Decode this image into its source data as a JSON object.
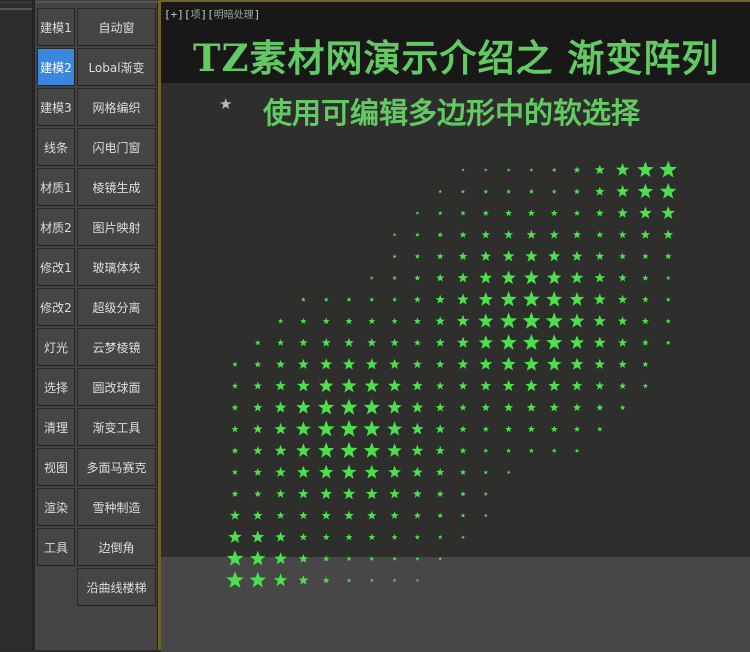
{
  "left_column": [
    "建模1",
    "建模2",
    "建模3",
    "线条",
    "材质1",
    "材质2",
    "修改1",
    "修改2",
    "灯光",
    "选择",
    "清理",
    "视图",
    "渲染",
    "工具"
  ],
  "active_index": 1,
  "right_column": [
    "自动窗",
    "Lobal渐变",
    "网格编织",
    "闪电门窗",
    "棱镜生成",
    "图片映射",
    "玻璃体块",
    "超级分离",
    "云梦棱镜",
    "圆改球面",
    "渐变工具",
    "多面马赛克",
    "雪种制造",
    "边倒角",
    "沿曲线楼梯"
  ],
  "viewport": {
    "label_plus": "[+]",
    "label_view": "项",
    "label_shading": "明暗处理",
    "title": "TZ素材网演示介绍之 渐变阵列",
    "subtitle": "使用可编辑多边形中的软选择"
  },
  "colors": {
    "accent": "#3a87e0",
    "star": "#4de04d",
    "title": "#63c963",
    "border": "#6e6226"
  }
}
